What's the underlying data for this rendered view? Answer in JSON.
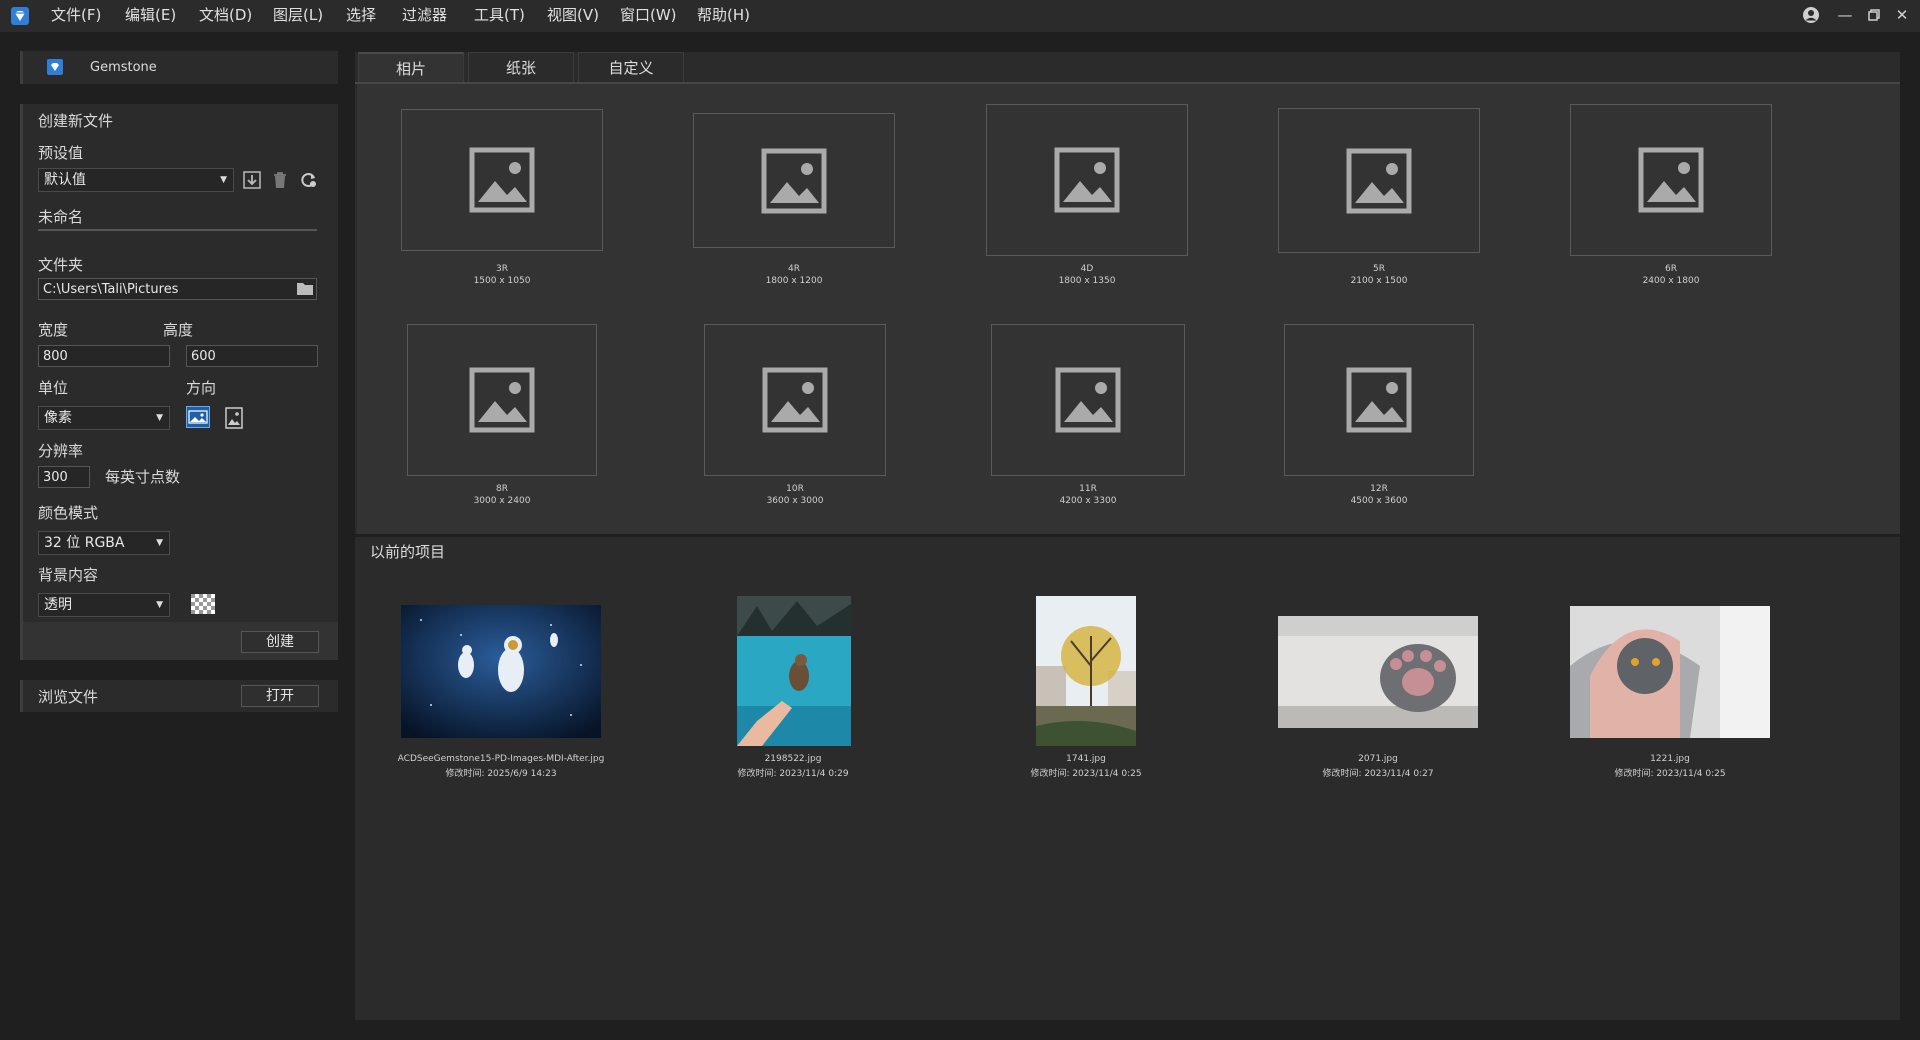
{
  "menubar": {
    "items": [
      "文件(F)",
      "编辑(E)",
      "文档(D)",
      "图层(L)",
      "选择",
      "过滤器",
      "工具(T)",
      "视图(V)",
      "窗口(W)",
      "帮助(H)"
    ]
  },
  "sidebar": {
    "app_name": "Gemstone",
    "create_section_title": "创建新文件",
    "preset_label": "预设值",
    "preset_value": "默认值",
    "filename": "未命名",
    "folder_label": "文件夹",
    "folder_value": "C:\\Users\\Tali\\Pictures",
    "width_label": "宽度",
    "height_label": "高度",
    "width_value": "800",
    "height_value": "600",
    "unit_label": "单位",
    "unit_value": "像素",
    "orientation_label": "方向",
    "resolution_label": "分辨率",
    "resolution_value": "300",
    "resolution_unit": "每英寸点数",
    "color_mode_label": "颜色模式",
    "color_mode_value": "32 位 RGBA",
    "background_label": "背景内容",
    "background_value": "透明",
    "create_button": "创建",
    "browse_label": "浏览文件",
    "open_button": "打开"
  },
  "tabs": [
    "相片",
    "纸张",
    "自定义"
  ],
  "papers": [
    {
      "name": "3R",
      "size": "1500 x 1050"
    },
    {
      "name": "4R",
      "size": "1800 x 1200"
    },
    {
      "name": "4D",
      "size": "1800 x 1350"
    },
    {
      "name": "5R",
      "size": "2100 x 1500"
    },
    {
      "name": "6R",
      "size": "2400 x 1800"
    },
    {
      "name": "8R",
      "size": "3000 x 2400"
    },
    {
      "name": "10R",
      "size": "3600 x 3000"
    },
    {
      "name": "11R",
      "size": "4200 x 3300"
    },
    {
      "name": "12R",
      "size": "4500 x 3600"
    }
  ],
  "recent": {
    "title": "以前的项目",
    "items": [
      {
        "name": "ACDSeeGemstone15-PD-Images-MDI-After.jpg",
        "date": "修改时间: 2025/6/9 14:23"
      },
      {
        "name": "2198522.jpg",
        "date": "修改时间: 2023/11/4 0:29"
      },
      {
        "name": "1741.jpg",
        "date": "修改时间: 2023/11/4 0:25"
      },
      {
        "name": "2071.jpg",
        "date": "修改时间: 2023/11/4 0:27"
      },
      {
        "name": "1221.jpg",
        "date": "修改时间: 2023/11/4 0:25"
      }
    ]
  },
  "colors": {
    "background": "#1f1f1f",
    "panel": "#2b2b2b",
    "content": "#333333",
    "accent": "#2f7fd8"
  }
}
